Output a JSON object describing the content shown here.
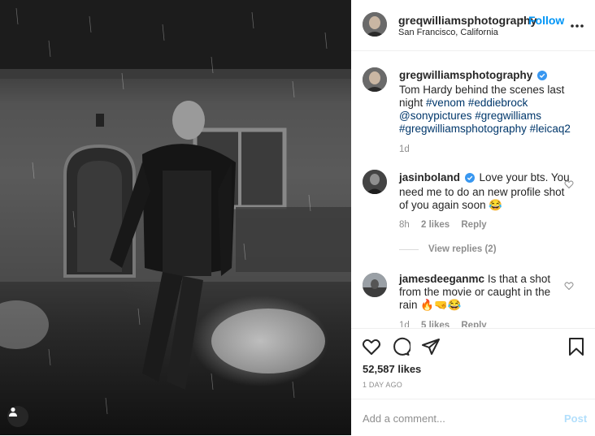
{
  "post": {
    "header": {
      "username": "greqwilliamsphotography",
      "dot": "•",
      "follow_label": "Follow",
      "location": "San Francisco, California",
      "more_icon": "more-horizontal-icon"
    },
    "caption": {
      "username": "gregwilliamsphotography",
      "text": "Tom Hardy behind the scenes last night",
      "tags": [
        "#venom",
        "#eddiebrock",
        "@sonypictures",
        "#gregwilliams",
        "#gregwilliamsphotography",
        "#leicaq2"
      ],
      "time": "1d"
    },
    "comments": [
      {
        "username": "jasinboland",
        "text": "Love your bts. You need me to do an new profile shot of you again soon 😂",
        "time": "8h",
        "likes": "2 likes",
        "reply": "Reply"
      },
      {
        "username": "jamesdeeganmc",
        "text": "Is that a shot from the movie or caught in the rain 🔥🤜😂",
        "time": "1d",
        "likes": "5 likes",
        "reply": "Reply"
      }
    ],
    "view_replies_label": "View replies (2)",
    "likes_count": "52,587 likes",
    "posted_ago": "1 DAY AGO",
    "add_comment_placeholder": "Add a comment...",
    "post_label": "Post"
  },
  "colors": {
    "accent": "#0095f6",
    "muted": "#8e8e8e",
    "post_disabled": "#b2dffc",
    "tag": "#00376b"
  }
}
